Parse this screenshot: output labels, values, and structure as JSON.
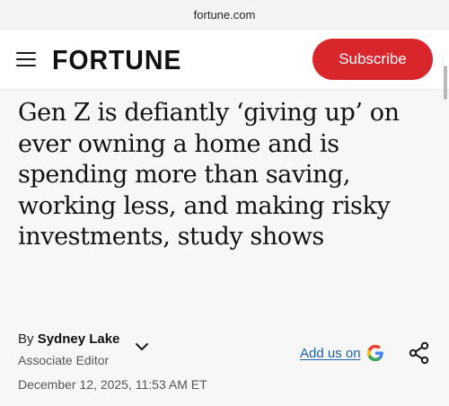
{
  "browser": {
    "url": "fortune.com"
  },
  "header": {
    "menu_icon": "hamburger-menu-icon",
    "logo": "FORTUNE",
    "subscribe_label": "Subscribe",
    "subscribe_color": "#d8262c"
  },
  "article": {
    "headline": "Gen Z is defiantly ‘giving up’ on ever owning a home and is spending more than saving, working less, and making risky investments, study shows",
    "byline_prefix": "By",
    "author": "Sydney Lake",
    "author_role": "Associate Editor",
    "date": "December 12, 2025, 11:53 AM ET",
    "add_us_label": "Add us on",
    "add_us_icon": "google-g-icon",
    "share_icon": "share-icon",
    "link_color": "#1c5ea8"
  }
}
